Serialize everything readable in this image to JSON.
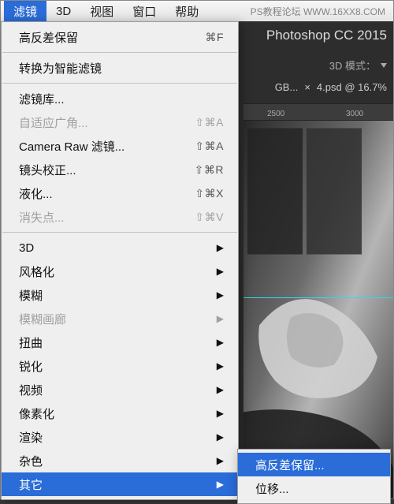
{
  "menubar": {
    "items": [
      "滤镜",
      "3D",
      "视图",
      "窗口",
      "帮助"
    ],
    "selected_index": 0,
    "watermark": "PS教程论坛 WWW.16XX8.COM"
  },
  "ps_background": {
    "app_title": "Photoshop CC 2015",
    "mode_label": "3D 模式：",
    "doc_label_left": "GB...",
    "doc_close": "×",
    "doc_label": "4.psd @ 16.7%",
    "ruler_ticks": [
      "2500",
      "3000"
    ]
  },
  "filter_menu": {
    "top": {
      "label": "高反差保留",
      "shortcut": "⌘F"
    },
    "convert": {
      "label": "转换为智能滤镜"
    },
    "group1": [
      {
        "label": "滤镜库...",
        "shortcut": "",
        "disabled": false
      },
      {
        "label": "自适应广角...",
        "shortcut": "⇧⌘A",
        "disabled": true
      },
      {
        "label": "Camera Raw 滤镜...",
        "shortcut": "⇧⌘A",
        "disabled": false
      },
      {
        "label": "镜头校正...",
        "shortcut": "⇧⌘R",
        "disabled": false
      },
      {
        "label": "液化...",
        "shortcut": "⇧⌘X",
        "disabled": false
      },
      {
        "label": "消失点...",
        "shortcut": "⇧⌘V",
        "disabled": true
      }
    ],
    "group2": [
      {
        "label": "3D",
        "disabled": false
      },
      {
        "label": "风格化",
        "disabled": false
      },
      {
        "label": "模糊",
        "disabled": false
      },
      {
        "label": "模糊画廊",
        "disabled": true
      },
      {
        "label": "扭曲",
        "disabled": false
      },
      {
        "label": "锐化",
        "disabled": false
      },
      {
        "label": "视频",
        "disabled": false
      },
      {
        "label": "像素化",
        "disabled": false
      },
      {
        "label": "渲染",
        "disabled": false
      },
      {
        "label": "杂色",
        "disabled": false
      },
      {
        "label": "其它",
        "disabled": false,
        "highlight": true
      }
    ]
  },
  "other_submenu": {
    "items": [
      {
        "label": "高反差保留...",
        "highlight": true
      },
      {
        "label": "位移...",
        "highlight": false
      }
    ]
  }
}
